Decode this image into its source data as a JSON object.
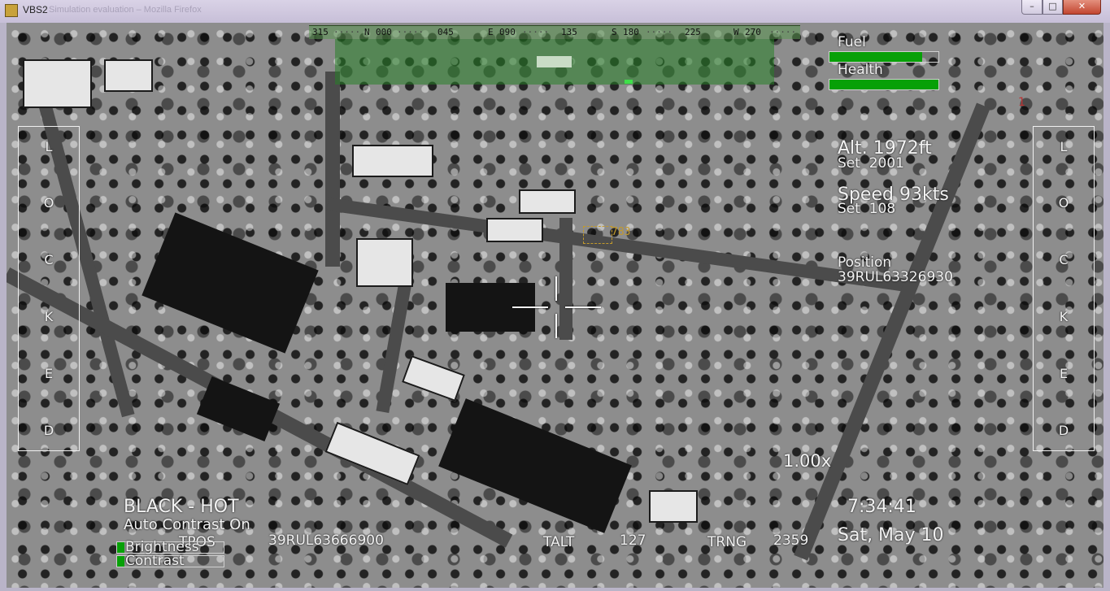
{
  "window": {
    "title": "VBS2",
    "faded_title": "Simulation evaluation – Mozilla Firefox",
    "controls": {
      "minimize": "–",
      "maximize": "□",
      "close": "✕"
    }
  },
  "hud": {
    "compass": [
      "315",
      "N",
      "000",
      "045",
      "E",
      "090",
      "135",
      "S",
      "180",
      "225",
      "W",
      "270"
    ],
    "compass_ticks": "·····",
    "fuel": {
      "label": "Fuel",
      "level": 0.85
    },
    "health": {
      "label": "Health",
      "level": 1.0
    },
    "warning_count": "1",
    "altitude": {
      "line": "Alt. 1972ft",
      "set": "Set  2001"
    },
    "speed": {
      "line": "Speed 93kts",
      "set": "Set  108"
    },
    "position": {
      "label": "Position",
      "value": "39RUL63326930"
    },
    "zoom": "1.00x",
    "mode": "BLACK - HOT",
    "auto_contrast": "Auto Contrast On",
    "brightness": {
      "label": "Brightness",
      "level": 0.07
    },
    "contrast": {
      "label": "Contrast",
      "level": 0.07
    },
    "tpos": {
      "label": "TPOS",
      "value": "39RUL63666900"
    },
    "talt": {
      "label": "TALT",
      "value": "127"
    },
    "trng": {
      "label": "TRNG",
      "value": "2359"
    },
    "time": "7:34:41",
    "date": "Sat, May 10",
    "target_id": "783",
    "locked_letters": [
      "L",
      "O",
      "C",
      "K",
      "E",
      "D"
    ]
  },
  "colors": {
    "hud_text": "#f2f2f2",
    "bar_green": "#07a007",
    "target_marker": "#c39a2b",
    "overlay_green": "#2f8a2f"
  }
}
